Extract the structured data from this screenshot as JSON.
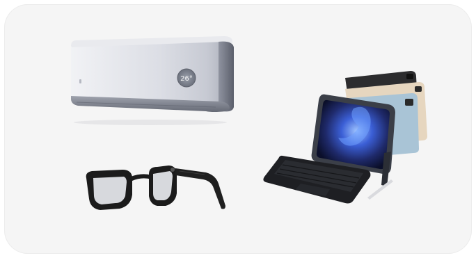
{
  "card": {
    "background": "#f5f5f5"
  },
  "products": [
    {
      "id": "air-conditioner",
      "icon": "air-conditioner-icon",
      "display_reading": "26°"
    },
    {
      "id": "smart-glasses",
      "icon": "smart-glasses-icon"
    },
    {
      "id": "tablet",
      "icon": "tablet-keyboard-icon"
    }
  ]
}
